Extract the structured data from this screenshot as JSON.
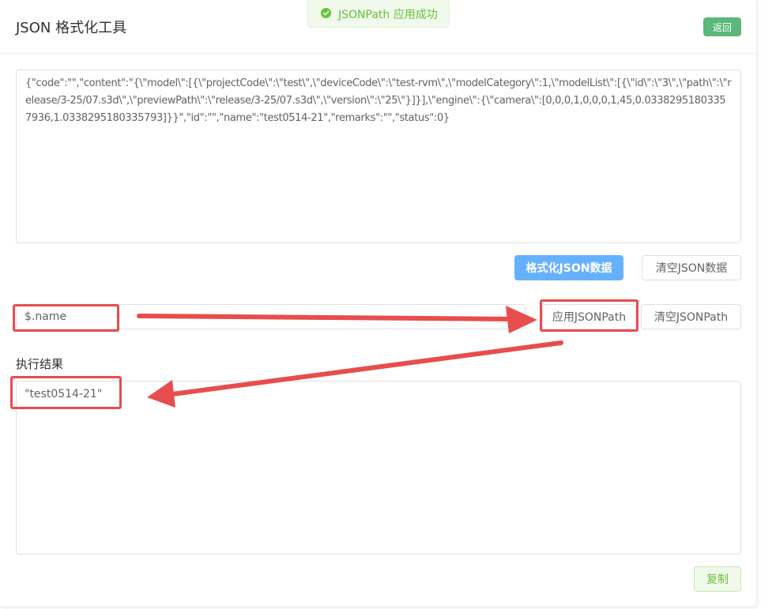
{
  "header": {
    "title": "JSON 格式化工具",
    "back_label": "返回"
  },
  "toast": {
    "message": "JSONPath 应用成功",
    "color": "#67c23a"
  },
  "editor": {
    "json_text": "{\"code\":\"\",\"content\":\"{\\\"model\\\":[{\\\"projectCode\\\":\\\"test\\\",\\\"deviceCode\\\":\\\"test-rvm\\\",\\\"modelCategory\\\":1,\\\"modelList\\\":[{\\\"id\\\":\\\"3\\\",\\\"path\\\":\\\"release/3-25/07.s3d\\\",\\\"previewPath\\\":\\\"release/3-25/07.s3d\\\",\\\"version\\\":\\\"25\\\"}]}],\\\"engine\\\":{\\\"camera\\\":[0,0,0,1,0,0,0,1,45,0.03382951803357936,1.0338295180335793]}}\",\"id\":\"\",\"name\":\"test0514-21\",\"remarks\":\"\",\"status\":0}",
    "format_label": "格式化JSON数据",
    "clear_label": "清空JSON数据"
  },
  "jsonpath": {
    "value": "$.name",
    "apply_label": "应用JSONPath",
    "clear_label": "清空JSONPath"
  },
  "result": {
    "label": "执行结果",
    "value": "\"test0514-21\"",
    "copy_label": "复制"
  },
  "annotation_color": "#e84d4d"
}
